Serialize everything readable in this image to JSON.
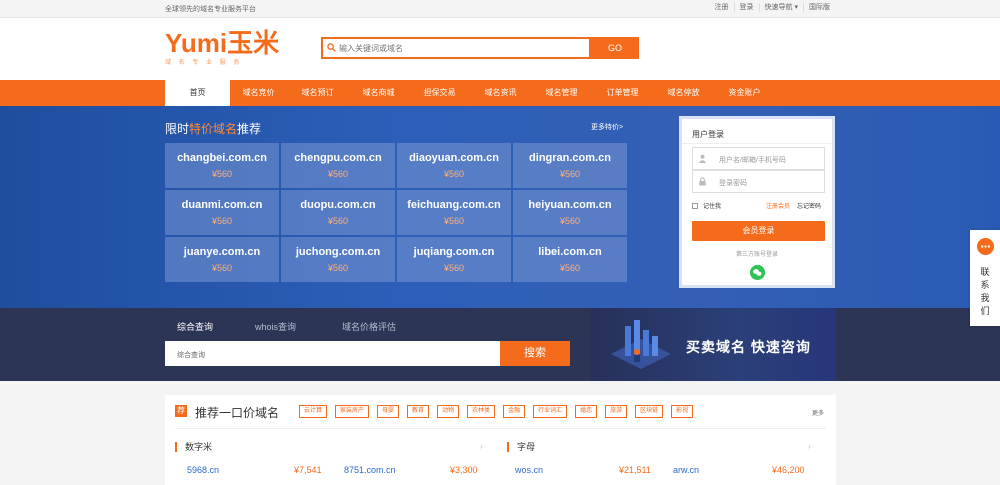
{
  "topbar": {
    "slogan": "全球领先的域名专业服务平台",
    "links": [
      "注册",
      "登录",
      "快速导航 ▾",
      "国际版"
    ]
  },
  "header": {
    "logo_text": "Yumi玉米",
    "logo_sub": "域 名 专 业 服 务",
    "search_placeholder": "输入关键词或域名",
    "go_label": "GO"
  },
  "nav": {
    "items": [
      "首页",
      "域名竞价",
      "域名预订",
      "域名商城",
      "担保交易",
      "域名资讯",
      "域名管理",
      "订单管理",
      "域名停放",
      "资金账户"
    ],
    "active_index": 0
  },
  "hero": {
    "title_prefix": "限时",
    "title_highlight": "特价域名",
    "title_suffix": "推荐",
    "more": "更多特价>",
    "cards": [
      {
        "domain": "changbei.com.cn",
        "price": "¥560"
      },
      {
        "domain": "chengpu.com.cn",
        "price": "¥560"
      },
      {
        "domain": "diaoyuan.com.cn",
        "price": "¥560"
      },
      {
        "domain": "dingran.com.cn",
        "price": "¥560"
      },
      {
        "domain": "duanmi.com.cn",
        "price": "¥560"
      },
      {
        "domain": "duopu.com.cn",
        "price": "¥560"
      },
      {
        "domain": "feichuang.com.cn",
        "price": "¥560"
      },
      {
        "domain": "heiyuan.com.cn",
        "price": "¥560"
      },
      {
        "domain": "juanye.com.cn",
        "price": "¥560"
      },
      {
        "domain": "juchong.com.cn",
        "price": "¥560"
      },
      {
        "domain": "juqiang.com.cn",
        "price": "¥560"
      },
      {
        "domain": "libei.com.cn",
        "price": "¥560"
      }
    ]
  },
  "login": {
    "title": "用户登录",
    "username_placeholder": "用户名/邮箱/手机号码",
    "password_placeholder": "登录密码",
    "remember": "记住我",
    "register": "注册会员",
    "forgot": "忘记密码",
    "submit": "会员登录",
    "third_party": "第三方账号登录"
  },
  "search": {
    "tabs": [
      "综合查询",
      "whois查询",
      "域名价格评估"
    ],
    "active_tab": 0,
    "input_placeholder": "综合查询",
    "button": "搜索"
  },
  "promo": {
    "text": "买卖域名 快速咨询"
  },
  "fixed_price": {
    "badge": "荐",
    "title": "推荐一口价域名",
    "tags": [
      "云计算",
      "家装房产",
      "母婴",
      "教育",
      "动物",
      "农林类",
      "金融",
      "行业词汇",
      "婚恋",
      "旅游",
      "区块链",
      "影视"
    ],
    "more": "更多",
    "categories": [
      {
        "name": "数字米",
        "rows": [
          {
            "domain": "5968.cn",
            "price": "¥7,541"
          },
          {
            "domain": "8751.com.cn",
            "price": "¥3,300"
          }
        ]
      },
      {
        "name": "字母",
        "rows": [
          {
            "domain": "wos.cn",
            "price": "¥21,511"
          },
          {
            "domain": "arw.cn",
            "price": "¥46,200"
          }
        ]
      }
    ]
  },
  "contact": {
    "label": "联系我们"
  },
  "colors": {
    "accent": "#f46b1b",
    "hero_blue": "#2d5fb8",
    "search_bar": "#2d3557",
    "link_blue": "#2b6bc9",
    "wechat_green": "#2ec254"
  }
}
